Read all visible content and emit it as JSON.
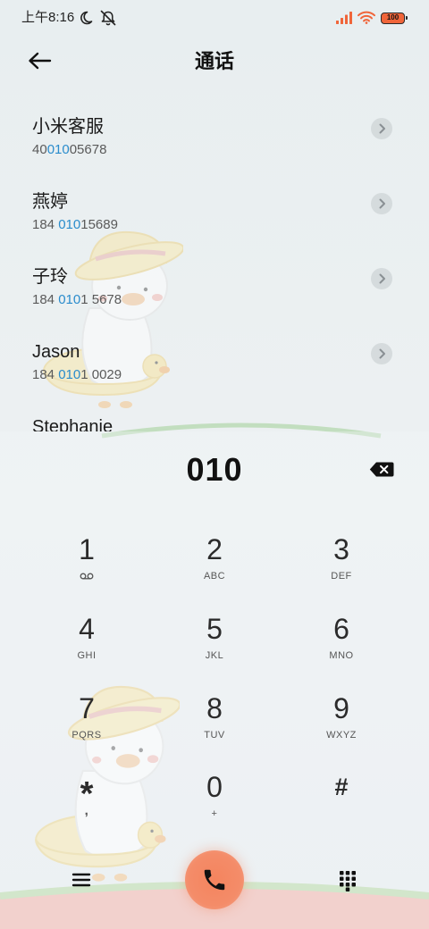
{
  "status_bar": {
    "time": "上午8:16",
    "battery": "100",
    "icons": [
      "moon-icon",
      "mute-icon",
      "signal-icon",
      "wifi-icon",
      "battery-icon"
    ]
  },
  "header": {
    "title": "通话",
    "back_icon": "back-arrow-icon"
  },
  "contacts": [
    {
      "name": "小米客服",
      "number_before": "40",
      "number_match": "010",
      "number_after": "05678"
    },
    {
      "name": "燕婷",
      "number_before": "184 ",
      "number_match": "010",
      "number_after": "15689"
    },
    {
      "name": "子玲",
      "number_before": "184 ",
      "number_match": "010",
      "number_after": "1 5678"
    },
    {
      "name": "Jason",
      "number_before": "184 ",
      "number_match": "010",
      "number_after": "1 0029"
    },
    {
      "name": "Stephanie"
    }
  ],
  "dialer": {
    "display": "010",
    "backspace_icon": "backspace-icon"
  },
  "keypad": [
    {
      "digit": "1",
      "icon": "voicemail-icon"
    },
    {
      "digit": "2",
      "letters": "ABC"
    },
    {
      "digit": "3",
      "letters": "DEF"
    },
    {
      "digit": "4",
      "letters": "GHI"
    },
    {
      "digit": "5",
      "letters": "JKL"
    },
    {
      "digit": "6",
      "letters": "MNO"
    },
    {
      "digit": "7",
      "letters": "PQRS"
    },
    {
      "digit": "8",
      "letters": "TUV"
    },
    {
      "digit": "9",
      "letters": "WXYZ"
    },
    {
      "digit": "*",
      "letters": ","
    },
    {
      "digit": "0",
      "letters": "+"
    },
    {
      "digit": "#"
    }
  ],
  "bottom_bar": {
    "left_icon": "menu-icon",
    "center_icon": "phone-icon",
    "right_icon": "dialpad-icon"
  },
  "colors": {
    "match_highlight": "#2a8ccc",
    "call_button": "#f4845e",
    "status_icons": "#f0653a"
  }
}
